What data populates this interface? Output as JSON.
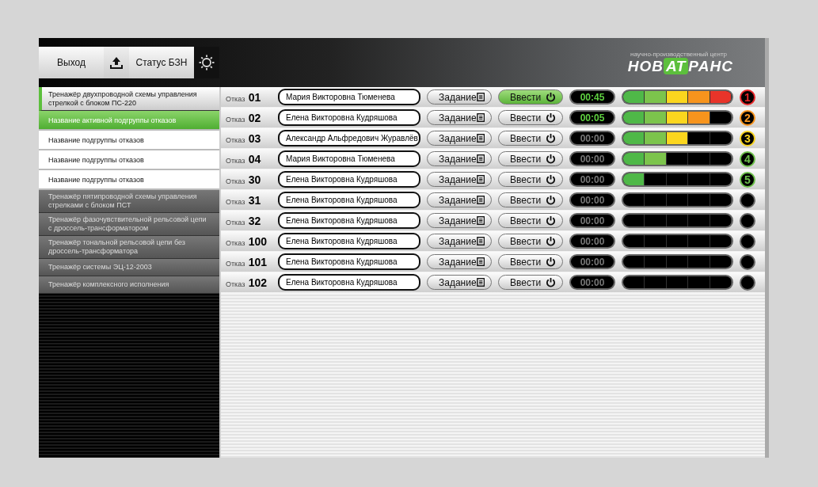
{
  "header": {
    "exit_button": "Выход",
    "status_button": "Статус БЗН",
    "logo": {
      "part1": "НОВ",
      "part2": "АТ",
      "part3": "РАНС",
      "tagline": "научно-производственный центр"
    }
  },
  "sidebar": {
    "items": [
      {
        "label": "Тренажёр двухпроводной схемы управления стрелкой с блоком ПС-220",
        "expanded": true,
        "children": [
          {
            "label": "Название активной подгруппы отказов",
            "selected": true
          },
          {
            "label": "Название подгруппы отказов",
            "selected": false
          },
          {
            "label": "Название подгруппы отказов",
            "selected": false
          },
          {
            "label": "Название подгруппы отказов",
            "selected": false
          }
        ]
      },
      {
        "label": "Тренажёр пятипроводной схемы управления стрелками с блоком ПСТ",
        "expanded": false
      },
      {
        "label": "Тренажёр фазочувствительной рельсовой цепи с дроссель-трансформатором",
        "expanded": false
      },
      {
        "label": "Тренажёр тональной рельсовой цепи без дроссель-трансформатора",
        "expanded": false
      },
      {
        "label": "Тренажёр системы ЭЦ-12-2003",
        "expanded": false
      },
      {
        "label": "Тренажёр комплексного исполнения",
        "expanded": false
      }
    ]
  },
  "rows": [
    {
      "prefix": "Отказ",
      "number": "01",
      "name": "Мария Викторовна Тюменева",
      "task": "Задание",
      "enter": "Ввести",
      "enter_active": true,
      "timer": "00:45",
      "timer_running": true,
      "level": 1.0,
      "badge": "1",
      "color": "#e8262a"
    },
    {
      "prefix": "Отказ",
      "number": "02",
      "name": "Елена Викторовна Кудряшова",
      "task": "Задание",
      "enter": "Ввести",
      "enter_active": false,
      "timer": "00:05",
      "timer_running": true,
      "level": 0.8,
      "badge": "2",
      "color": "#f7941d"
    },
    {
      "prefix": "Отказ",
      "number": "03",
      "name": "Александр Альфредович Журавлёв",
      "task": "Задание",
      "enter": "Ввести",
      "enter_active": false,
      "timer": "00:00",
      "timer_running": false,
      "level": 0.6,
      "badge": "3",
      "color": "#f6d21c"
    },
    {
      "prefix": "Отказ",
      "number": "04",
      "name": "Мария Викторовна Тюменева",
      "task": "Задание",
      "enter": "Ввести",
      "enter_active": false,
      "timer": "00:00",
      "timer_running": false,
      "level": 0.4,
      "badge": "4",
      "color": "#6cc04a"
    },
    {
      "prefix": "Отказ",
      "number": "30",
      "name": "Елена Викторовна Кудряшова",
      "task": "Задание",
      "enter": "Ввести",
      "enter_active": false,
      "timer": "00:00",
      "timer_running": false,
      "level": 0.2,
      "badge": "5",
      "color": "#6cc04a"
    },
    {
      "prefix": "Отказ",
      "number": "31",
      "name": "Елена Викторовна Кудряшова",
      "task": "Задание",
      "enter": "Ввести",
      "enter_active": false,
      "timer": "00:00",
      "timer_running": false
    },
    {
      "prefix": "Отказ",
      "number": "32",
      "name": "Елена Викторовна Кудряшова",
      "task": "Задание",
      "enter": "Ввести",
      "enter_active": false,
      "timer": "00:00",
      "timer_running": false
    },
    {
      "prefix": "Отказ",
      "number": "100",
      "name": "Елена Викторовна Кудряшова",
      "task": "Задание",
      "enter": "Ввести",
      "enter_active": false,
      "timer": "00:00",
      "timer_running": false
    },
    {
      "prefix": "Отказ",
      "number": "101",
      "name": "Елена Викторовна Кудряшова",
      "task": "Задание",
      "enter": "Ввести",
      "enter_active": false,
      "timer": "00:00",
      "timer_running": false
    },
    {
      "prefix": "Отказ",
      "number": "102",
      "name": "Елена Викторовна Кудряшова",
      "task": "Задание",
      "enter": "Ввести",
      "enter_active": false,
      "timer": "00:00",
      "timer_running": false
    }
  ]
}
